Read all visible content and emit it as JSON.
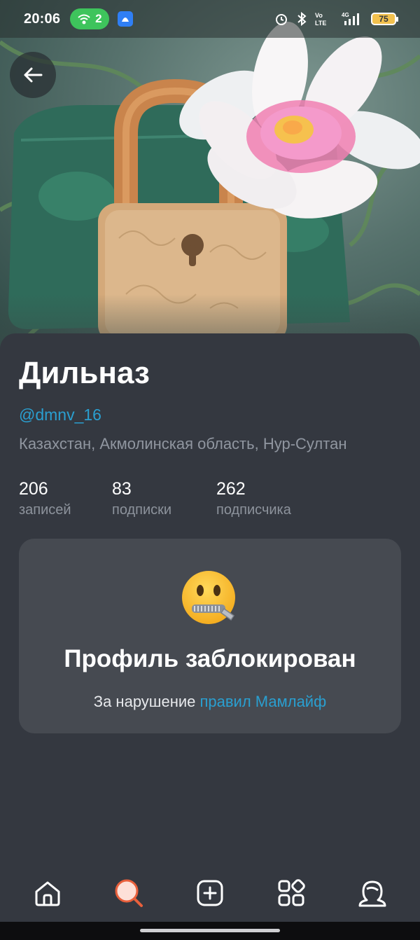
{
  "status_bar": {
    "time": "20:06",
    "hotspot_count": "2",
    "battery_level": "75",
    "icons": [
      "wifi-hotspot-icon",
      "app-notification-icon",
      "alarm-icon",
      "bluetooth-icon",
      "volte-icon",
      "signal-4g-icon",
      "battery-icon"
    ]
  },
  "cover": {
    "image": "padlock-with-lotus-flower",
    "colors": {
      "sky": "#7f9892",
      "leaf": "#2f6b5a",
      "lock": "#d4a97a",
      "petal": "#f6f0f2",
      "petal_center": "#f07fb2"
    }
  },
  "header": {
    "back_icon": "arrow-left-icon"
  },
  "profile": {
    "name": "Дильназ",
    "handle": "@dmnv_16",
    "location": "Казахстан, Акмолинская область, Нур-Султан",
    "stats": [
      {
        "value": "206",
        "label": "записей"
      },
      {
        "value": "83",
        "label": "подписки"
      },
      {
        "value": "262",
        "label": "подписчика"
      }
    ]
  },
  "blocked": {
    "emoji": "zipper-mouth-face",
    "title": "Профиль заблокирован",
    "subtitle_prefix": "За нарушение ",
    "rules_link": "правил Мамлайф"
  },
  "nav": {
    "items": [
      {
        "icon": "home-icon",
        "active": false
      },
      {
        "icon": "search-icon",
        "active": true
      },
      {
        "icon": "add-post-icon",
        "active": false
      },
      {
        "icon": "apps-grid-icon",
        "active": false
      },
      {
        "icon": "profile-icon",
        "active": false
      }
    ]
  },
  "colors": {
    "background": "#343840",
    "card": "#464a51",
    "accent_link": "#2a9fd0",
    "muted_text": "#9096a0",
    "search_active": "#e8603c"
  }
}
